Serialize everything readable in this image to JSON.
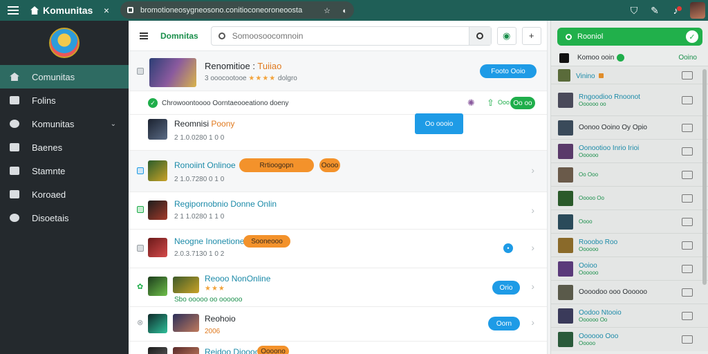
{
  "browser": {
    "tab_title": "Komunitas",
    "tab_close": "×",
    "url": "bromotioneosygneosono.conitioconeoroneoosta",
    "url_icons": [
      "☆",
      "◐"
    ],
    "toolbar_icons": [
      "shield-icon",
      "puzzle-icon",
      "bell-icon"
    ]
  },
  "sidebar": {
    "items": [
      {
        "label": "Comunitas",
        "icon": "home-icon",
        "active": true
      },
      {
        "label": "Folins",
        "icon": "chat-icon"
      },
      {
        "label": "Komunitas",
        "icon": "people-icon",
        "chevron": "⌄"
      },
      {
        "label": "Baenes",
        "icon": "game-icon"
      },
      {
        "label": "Stamnte",
        "icon": "grid-icon"
      },
      {
        "label": "Koroaed",
        "icon": "keyboard-icon"
      },
      {
        "label": "Disoetais",
        "icon": "settings-icon"
      }
    ]
  },
  "main": {
    "title": "Domnitas",
    "search_placeholder": "Somoosoocomnoin",
    "header_btn_plus": "+",
    "header_btn_check": "◉",
    "featured": {
      "title": "Renomitioe",
      "title_accent": "Tuiiao",
      "subtitle": "3 ooocootooe",
      "stars": "★★★★",
      "rating_text": "dolgro",
      "button": "Footo Ooio"
    },
    "notice": {
      "text": "Chrowoontoooo Oorntaeooeationo doeny",
      "button": "Oo oo",
      "extra_badge": "Ooo"
    },
    "pinned": {
      "title": "Reomnisi",
      "title_accent": "Poony",
      "subtitle": "2 1.0.0280 1 0 0",
      "button": "Oo oooio"
    },
    "posts": [
      {
        "title": "Ronoiint Onlinoe",
        "subtitle": "2 1.0.7280 0 1 0",
        "tag": "Rrtioogopn",
        "tag2": "Oooo"
      },
      {
        "title": "Regipornobnio Donne Onlin",
        "subtitle": "2 1 1.0280 1 1 0"
      },
      {
        "title": "Neogne Inonetione",
        "subtitle": "2.0.3.7130 1 0 2",
        "tag": "Sooneooo",
        "dot": "•"
      },
      {
        "title": "Reooo NonOnline",
        "subtitle": "Sbo ooooo oo oooooo",
        "stars": "★★★",
        "button": "Orio"
      },
      {
        "title": "Reohoio",
        "subtitle": "2006",
        "button": "Oorn"
      },
      {
        "title": "Reidoo Dioooo",
        "tag": "Oooono"
      }
    ]
  },
  "right": {
    "search_label": "Rooniol",
    "header_title": "Komoo ooin",
    "header_link": "Ooino",
    "rows": [
      {
        "name": "Vinino",
        "sub": ""
      },
      {
        "name": "Rngoodioo Rnoonot",
        "sub": "Oooooo oo"
      },
      {
        "name": "Oonoo Ooino Oy Opio",
        "sub": ""
      },
      {
        "name": "Oonootioo Inrio Irioi",
        "sub": "Oooooo"
      },
      {
        "name": "",
        "sub": "Oo Ooo"
      },
      {
        "name": "",
        "sub": "Ooooo Oo"
      },
      {
        "name": "",
        "sub": "Oooo"
      },
      {
        "name": "Rooobo Roo",
        "sub": "Oooooo"
      },
      {
        "name": "Ooioo",
        "sub": "Oooooo"
      },
      {
        "name": "Oooodoo ooo Oooooo",
        "sub": ""
      },
      {
        "name": "Oodoo Ntooio",
        "sub": "Oooooo Oo"
      },
      {
        "name": "Oooooo Ooo",
        "sub": "Ooooo"
      }
    ]
  },
  "colors": {
    "topbar": "#1f5f57",
    "sidebar": "#24292d",
    "sidebar_active": "#2e6b62",
    "accent_green": "#1fae4b",
    "accent_blue": "#1e9be6",
    "accent_orange": "#f3922b"
  }
}
